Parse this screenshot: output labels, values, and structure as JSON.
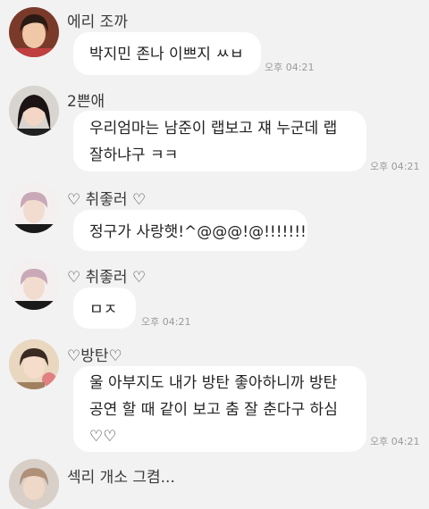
{
  "messages": [
    {
      "sender": "에리 조까",
      "lines": [
        "박지민 존나 이쁘지 ㅆㅂ"
      ],
      "time": "오후 04:21",
      "avatar": "avatar-photo-woman-icon"
    },
    {
      "sender": "2쁜애",
      "lines": [
        "우리엄마는 남준이 랩보고 쟤 누군데 랩",
        "잘하냐구 ㅋㅋ"
      ],
      "time": "오후 04:21",
      "avatar": "avatar-photo-girl-icon"
    },
    {
      "sender": "♡ 취좋러 ♡",
      "lines": [
        "정구가 사랑햇!^@@@!@!!!!!!!"
      ],
      "time": "",
      "avatar": "avatar-photo-boy-icon"
    },
    {
      "sender": "♡ 취좋러 ♡",
      "lines": [
        "ㅁㅈ"
      ],
      "time": "오후 04:21",
      "avatar": "avatar-photo-boy-icon"
    },
    {
      "sender": "♡방탄♡",
      "lines": [
        "울 아부지도 내가 방탄 좋아하니까 방탄",
        "공연 할 때 같이 보고 춤 잘 춘다구 하심",
        "♡♡"
      ],
      "time": "오후 04:21",
      "avatar": "avatar-photo-doll-icon"
    },
    {
      "sender": "섹리 개소 그켬...",
      "lines": [],
      "time": "",
      "avatar": "avatar-photo-partial-icon"
    }
  ]
}
